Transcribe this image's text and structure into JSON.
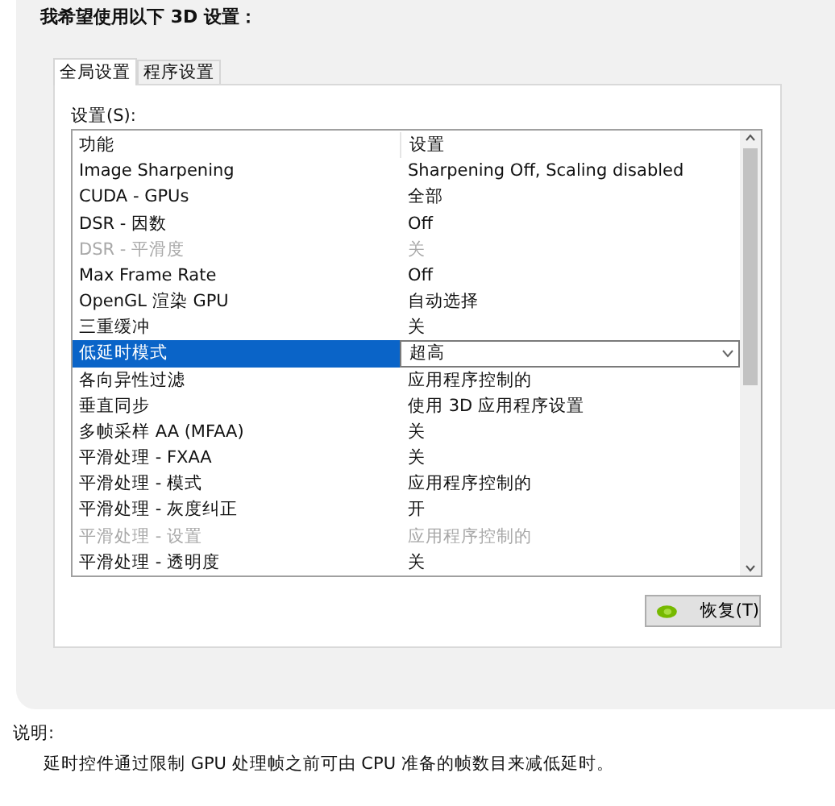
{
  "heading": "我希望使用以下 3D 设置：",
  "tabs": [
    {
      "label": "全局设置",
      "selected": true
    },
    {
      "label": "程序设置",
      "selected": false
    }
  ],
  "settings_label": "设置(S):",
  "table": {
    "columns": [
      "功能",
      "设置"
    ],
    "rows": [
      {
        "feature": "Image Sharpening",
        "setting": "Sharpening Off, Scaling disabled",
        "disabled": false,
        "selected": false
      },
      {
        "feature": "CUDA - GPUs",
        "setting": "全部",
        "disabled": false,
        "selected": false
      },
      {
        "feature": "DSR - 因数",
        "setting": "Off",
        "disabled": false,
        "selected": false
      },
      {
        "feature": "DSR - 平滑度",
        "setting": "关",
        "disabled": true,
        "selected": false
      },
      {
        "feature": "Max Frame Rate",
        "setting": "Off",
        "disabled": false,
        "selected": false
      },
      {
        "feature": "OpenGL 渲染 GPU",
        "setting": "自动选择",
        "disabled": false,
        "selected": false
      },
      {
        "feature": "三重缓冲",
        "setting": "关",
        "disabled": false,
        "selected": false
      },
      {
        "feature": "低延时模式",
        "setting": "超高",
        "disabled": false,
        "selected": true
      },
      {
        "feature": "各向异性过滤",
        "setting": "应用程序控制的",
        "disabled": false,
        "selected": false
      },
      {
        "feature": "垂直同步",
        "setting": "使用 3D 应用程序设置",
        "disabled": false,
        "selected": false
      },
      {
        "feature": "多帧采样 AA (MFAA)",
        "setting": "关",
        "disabled": false,
        "selected": false
      },
      {
        "feature": "平滑处理 - FXAA",
        "setting": "关",
        "disabled": false,
        "selected": false
      },
      {
        "feature": "平滑处理 - 模式",
        "setting": "应用程序控制的",
        "disabled": false,
        "selected": false
      },
      {
        "feature": "平滑处理 - 灰度纠正",
        "setting": "开",
        "disabled": false,
        "selected": false
      },
      {
        "feature": "平滑处理 - 设置",
        "setting": "应用程序控制的",
        "disabled": true,
        "selected": false
      },
      {
        "feature": "平滑处理 - 透明度",
        "setting": "关",
        "disabled": false,
        "selected": false
      }
    ]
  },
  "restore_button": "恢复(T)",
  "description": {
    "title": "说明:",
    "text": "延时控件通过限制 GPU 处理帧之前可由 CPU 准备的帧数目来减低延时。"
  }
}
